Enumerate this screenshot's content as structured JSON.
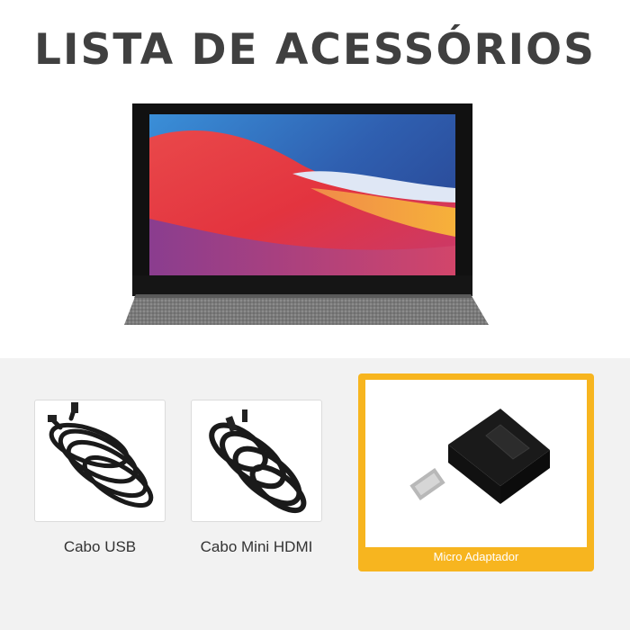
{
  "title": "LISTA DE ACESSÓRIOS",
  "accessories": [
    {
      "label": "Cabo USB",
      "icon": "usb-cable-icon"
    },
    {
      "label": "Cabo Mini HDMI",
      "icon": "mini-hdmi-cable-icon"
    },
    {
      "label": "Micro Adaptador",
      "icon": "micro-hdmi-adapter-icon"
    }
  ],
  "colors": {
    "title": "#404040",
    "highlight_frame": "#f7b51f",
    "bottom_background": "#f2f2f2"
  }
}
